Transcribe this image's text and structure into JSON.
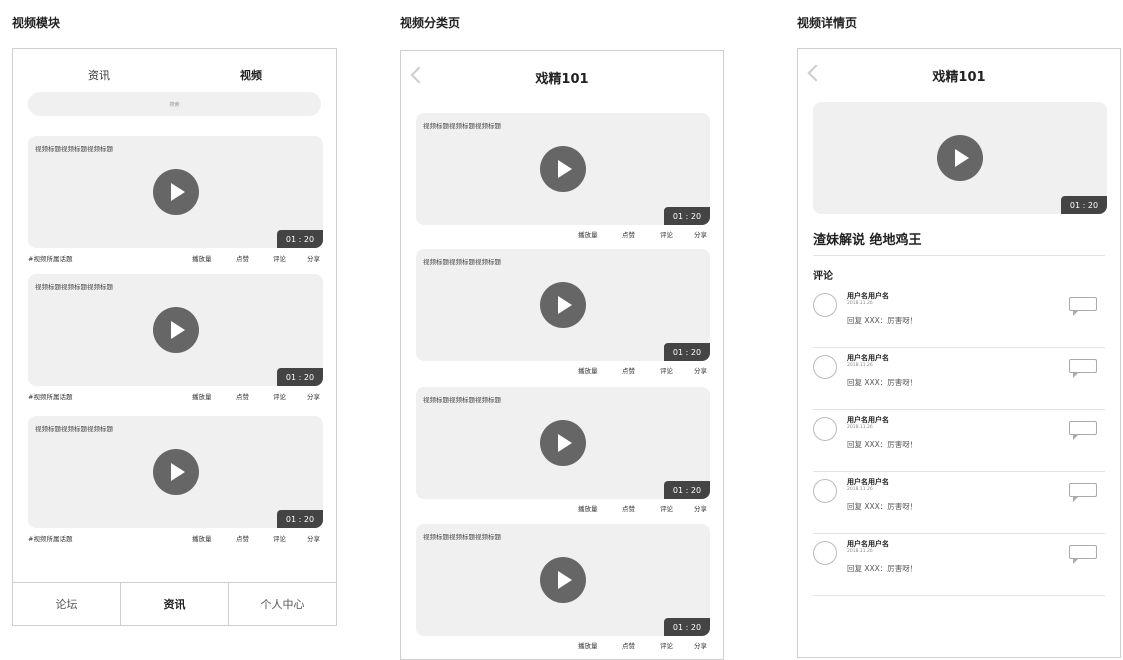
{
  "sections": {
    "s1": "视频模块",
    "s2": "视频分类页",
    "s3": "视频详情页"
  },
  "screen1": {
    "tabs": [
      "资讯",
      "视频"
    ],
    "search_placeholder": "搜索",
    "cards": [
      {
        "title": "视频标题视频标题视频标题",
        "duration": "01 : 20",
        "topic": "#视频所属话题"
      },
      {
        "title": "视频标题视频标题视频标题",
        "duration": "01 : 20",
        "topic": "#视频所属话题"
      },
      {
        "title": "视频标题视频标题视频标题",
        "duration": "01 : 20",
        "topic": "#视频所属话题"
      }
    ],
    "stat_labels": [
      "播放量",
      "点赞",
      "评论",
      "分享"
    ],
    "bottom_nav": [
      "论坛",
      "资讯",
      "个人中心"
    ]
  },
  "screen2": {
    "title": "戏精101",
    "cards": [
      {
        "title": "视频标题视频标题视频标题",
        "duration": "01 : 20"
      },
      {
        "title": "视频标题视频标题视频标题",
        "duration": "01 : 20"
      },
      {
        "title": "视频标题视频标题视频标题",
        "duration": "01 : 20"
      },
      {
        "title": "视频标题视频标题视频标题",
        "duration": "01 : 20"
      }
    ],
    "stat_labels": [
      "播放量",
      "点赞",
      "评论",
      "分享"
    ]
  },
  "screen3": {
    "title": "戏精101",
    "duration": "01 : 20",
    "video_title": "渣妹解说  绝地鸡王",
    "comments_header": "评论",
    "comments": [
      {
        "user": "用户名用户名",
        "date": "2018.11.26",
        "text": "回复 XXX：厉害呀！"
      },
      {
        "user": "用户名用户名",
        "date": "2018.11.26",
        "text": "回复 XXX：厉害呀！"
      },
      {
        "user": "用户名用户名",
        "date": "2018.11.26",
        "text": "回复 XXX：厉害呀！"
      },
      {
        "user": "用户名用户名",
        "date": "2018.11.26",
        "text": "回复 XXX：厉害呀！"
      },
      {
        "user": "用户名用户名",
        "date": "2018.11.26",
        "text": "回复 XXX：厉害呀！"
      }
    ]
  }
}
